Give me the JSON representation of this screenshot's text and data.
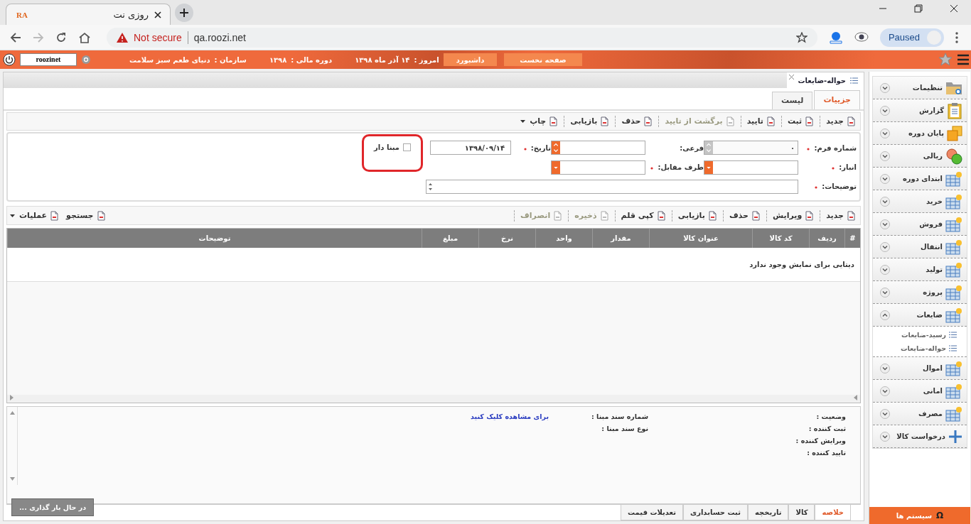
{
  "browser": {
    "tab": {
      "favicon": "RA",
      "title": "روزی نت"
    },
    "security": "Not secure",
    "url": "qa.roozi.net",
    "profile": "Paused"
  },
  "header": {
    "user": "roozinet",
    "nav_buttons": [
      "صفحه نخست",
      "داشبورد"
    ],
    "info": [
      {
        "label": "امروز :",
        "value": "۱۴ آذر ماه ۱۳۹۸"
      },
      {
        "label": "دوره مالی :",
        "value": "۱۳۹۸"
      },
      {
        "label": "سازمان :",
        "value": "دنیای طعم سبز سلامت"
      }
    ]
  },
  "document_tab": {
    "title": "حواله-ضایعات"
  },
  "view_tabs": [
    {
      "label": "جزییات",
      "selected": true
    },
    {
      "label": "لیست",
      "selected": false
    }
  ],
  "toolbar": [
    {
      "label": "جدید",
      "disabled": false,
      "menu": false
    },
    {
      "label": "ثبت",
      "disabled": false,
      "menu": false
    },
    {
      "label": "تایید",
      "disabled": false,
      "menu": false
    },
    {
      "label": "برگشت از تایید",
      "disabled": true,
      "menu": false
    },
    {
      "label": "حذف",
      "disabled": false,
      "menu": false
    },
    {
      "label": "بازیابی",
      "disabled": false,
      "menu": false
    },
    {
      "label": "چاپ",
      "disabled": false,
      "menu": true
    }
  ],
  "form": {
    "rows": [
      [
        {
          "kind": "spinner",
          "label": "شماره فرم:",
          "required": true,
          "disabled": true,
          "value": "۰"
        },
        {
          "kind": "spinner",
          "label": "فرعی:",
          "required": false,
          "disabled": false
        },
        {
          "kind": "date",
          "label": "تاریخ:",
          "required": true,
          "value": "۱۳۹۸/۰۹/۱۴"
        },
        {
          "kind": "checkbox",
          "label": "مبنا دار",
          "checked": false,
          "highlighted": true
        }
      ],
      [
        {
          "kind": "combo",
          "label": "انبار:",
          "required": true,
          "disabled": false
        },
        {
          "kind": "combo",
          "label": "طرف مقابل:",
          "required": true,
          "disabled": false
        }
      ],
      [
        {
          "kind": "textarea",
          "label": "توضیحات:",
          "required": true
        }
      ]
    ]
  },
  "items_toolbar": {
    "actions": [
      {
        "label": "جدید",
        "disabled": false
      },
      {
        "label": "ویرایش",
        "disabled": false
      },
      {
        "label": "حذف",
        "disabled": false
      },
      {
        "label": "بازیابی",
        "disabled": false
      },
      {
        "label": "کپی قلم",
        "disabled": false
      },
      {
        "label": "ذخیره",
        "disabled": true
      },
      {
        "label": "انصراف",
        "disabled": true
      }
    ],
    "tools": [
      {
        "label": "جستجو",
        "menu": false
      },
      {
        "label": "عملیات",
        "menu": true
      }
    ]
  },
  "table": {
    "columns": [
      "#",
      "ردیف",
      "کد کالا",
      "عنوان کالا",
      "مقدار",
      "واحد",
      "نرخ",
      "مبلغ",
      "توضیحات"
    ],
    "empty_message": "دیتایی برای نمایش وجود ندارد"
  },
  "summary": {
    "columns": [
      [
        {
          "label": "وضعیت :"
        },
        {
          "label": "ثبت کننده :"
        },
        {
          "label": "ویرایش کننده :"
        },
        {
          "label": "تایید کننده :"
        }
      ],
      [
        {
          "label": "شماره سند مبنا :",
          "link": "برای مشاهده کلیک کنید"
        },
        {
          "label": "نوع سند مبنا :"
        }
      ]
    ],
    "loading": "در حال بار گذاری ..."
  },
  "bottom_tabs": [
    {
      "label": "خلاصه",
      "selected": true
    },
    {
      "label": "کالا",
      "selected": false
    },
    {
      "label": "تاریخچه",
      "selected": false
    },
    {
      "label": "ثبت حسابداری",
      "selected": false
    },
    {
      "label": "تعدیلات قیمت",
      "selected": false
    }
  ],
  "sidebar": {
    "items": [
      {
        "label": "تنظیمات",
        "expanded": false
      },
      {
        "label": "گزارش",
        "expanded": false
      },
      {
        "label": "پایان دوره",
        "expanded": false
      },
      {
        "label": "ریالی",
        "expanded": false
      },
      {
        "label": "ابتدای دوره",
        "expanded": false
      },
      {
        "label": "خرید",
        "expanded": false
      },
      {
        "label": "فروش",
        "expanded": false
      },
      {
        "label": "انتقال",
        "expanded": false
      },
      {
        "label": "تولید",
        "expanded": false
      },
      {
        "label": "پروژه",
        "expanded": false
      },
      {
        "label": "ضایعات",
        "expanded": true,
        "children": [
          {
            "label": "رسید-ضایعات"
          },
          {
            "label": "حواله-ضایعات"
          }
        ]
      },
      {
        "label": "اموال",
        "expanded": false
      },
      {
        "label": "امانی",
        "expanded": false
      },
      {
        "label": "مصرف",
        "expanded": false
      },
      {
        "label": "درخواست کالا",
        "expanded": false
      }
    ],
    "footer_button": {
      "icon": "Ω",
      "label": "سیستم ها"
    }
  }
}
